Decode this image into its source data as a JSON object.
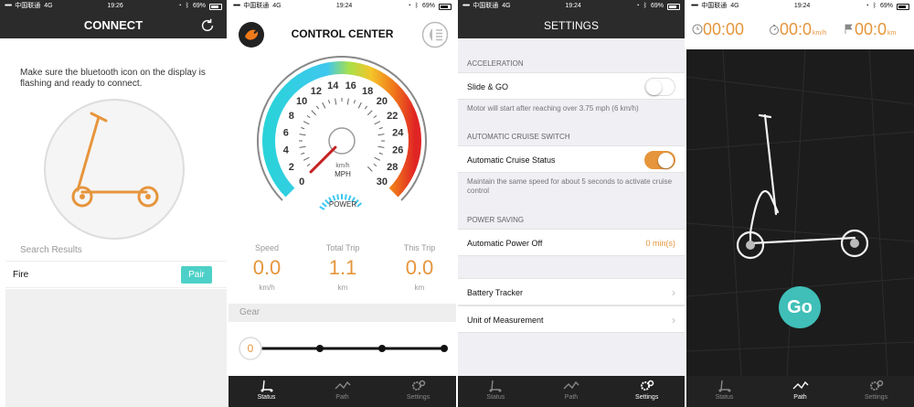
{
  "status_bars": [
    {
      "carrier": "中国联通",
      "network": "4G",
      "time": "19:26",
      "battery": "69%"
    },
    {
      "carrier": "中国联通",
      "network": "4G",
      "time": "19:24",
      "battery": "69%"
    },
    {
      "carrier": "中国联通",
      "network": "4G",
      "time": "19:24",
      "battery": "69%"
    },
    {
      "carrier": "中国联通",
      "network": "4G",
      "time": "19:24",
      "battery": "69%"
    }
  ],
  "connect": {
    "title": "CONNECT",
    "instructions": "Make sure the bluetooth icon on the display is flashing and ready to connect.",
    "search_results_label": "Search Results",
    "devices": [
      {
        "name": "Fire",
        "action": "Pair"
      }
    ]
  },
  "control_center": {
    "title": "CONTROL CENTER",
    "gauge": {
      "unit": "MPH",
      "mode": "POWER",
      "ticks": [
        "0",
        "2",
        "4",
        "6",
        "8",
        "10",
        "12",
        "14",
        "16",
        "18",
        "20",
        "22",
        "24",
        "26",
        "28",
        "30"
      ],
      "needle_value": 0
    },
    "stats": [
      {
        "label": "Speed",
        "value": "0.0",
        "unit": "km/h"
      },
      {
        "label": "Total Trip",
        "value": "1.1",
        "unit": "km"
      },
      {
        "label": "This Trip",
        "value": "0.0",
        "unit": "km"
      }
    ],
    "gear_label": "Gear",
    "gear_value": "0"
  },
  "settings": {
    "title": "SETTINGS",
    "sections": {
      "acceleration": "ACCELERATION",
      "cruise": "AUTOMATIC CRUISE SWITCH",
      "power": "POWER SAVING"
    },
    "slide_go": {
      "label": "Slide & GO",
      "on": false,
      "note": "Motor will start after reaching over 3.75 mph (6 km/h)"
    },
    "cruise_status": {
      "label": "Automatic Cruise Status",
      "on": true,
      "note": "Maintain the same speed for about 5 seconds to activate cruise control"
    },
    "auto_power_off": {
      "label": "Automatic Power Off",
      "value": "0 min(s)"
    },
    "battery_tracker": "Battery Tracker",
    "unit_of_measurement": "Unit of Measurement"
  },
  "path": {
    "time_value": "00:00",
    "speed_value": "00:0",
    "speed_unit": "km/h",
    "distance_value": "00:0",
    "distance_unit": "km",
    "go_label": "Go"
  },
  "tabs": [
    "Status",
    "Path",
    "Settings"
  ],
  "colors": {
    "accent": "#e6953c",
    "teal": "#4dd0c7",
    "dark": "#2b2b2b"
  }
}
